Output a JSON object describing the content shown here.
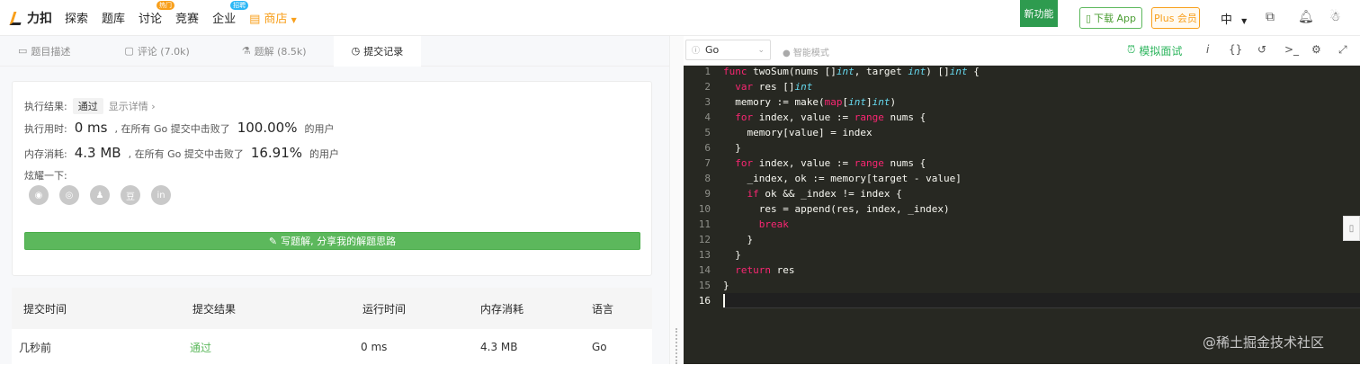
{
  "nav": {
    "logo": "力扣",
    "items": [
      "探索",
      "题库",
      "讨论",
      "竞赛",
      "企业"
    ],
    "badges": {
      "discuss": "热门",
      "enterprise": "招聘"
    },
    "store": "商店",
    "new_feature": "新功能",
    "download_app": "下载 App",
    "plus": "Plus 会员",
    "language": "中"
  },
  "tabs": [
    {
      "label": "题目描述",
      "icon": "document-icon"
    },
    {
      "label": "评论 (7.0k)",
      "icon": "comment-icon"
    },
    {
      "label": "题解 (8.5k)",
      "icon": "flask-icon"
    },
    {
      "label": "提交记录",
      "icon": "clock-icon"
    }
  ],
  "result": {
    "status_label": "执行结果:",
    "status": "通过",
    "detail": "显示详情",
    "runtime_label": "执行用时:",
    "runtime": "0 ms",
    "runtime_mid": ", 在所有 Go 提交中击败了",
    "runtime_pct": "100.00%",
    "users": "的用户",
    "memory_label": "内存消耗:",
    "memory": "4.3 MB",
    "memory_mid": ", 在所有 Go 提交中击败了",
    "memory_pct": "16.91%",
    "share_label": "炫耀一下:",
    "share_icons": [
      "wechat-icon",
      "weibo-icon",
      "qq-icon",
      "douban-icon",
      "linkedin-icon"
    ],
    "write_button": "写题解, 分享我的解题思路"
  },
  "table": {
    "headers": [
      "提交时间",
      "提交结果",
      "运行时间",
      "内存消耗",
      "语言"
    ],
    "rows": [
      [
        "几秒前",
        "通过",
        "0 ms",
        "4.3 MB",
        "Go"
      ]
    ]
  },
  "editor": {
    "language": "Go",
    "smart_mode": "智能模式",
    "mock_interview": "模拟面试",
    "line_numbers": [
      "1",
      "2",
      "3",
      "4",
      "5",
      "6",
      "7",
      "8",
      "9",
      "10",
      "11",
      "12",
      "13",
      "14",
      "15",
      "16"
    ]
  },
  "watermark": "@稀土掘金技术社区",
  "colors": {
    "accent_green": "#5cb85c",
    "brand_orange": "#f89f1b",
    "editor_bg": "#272822"
  }
}
